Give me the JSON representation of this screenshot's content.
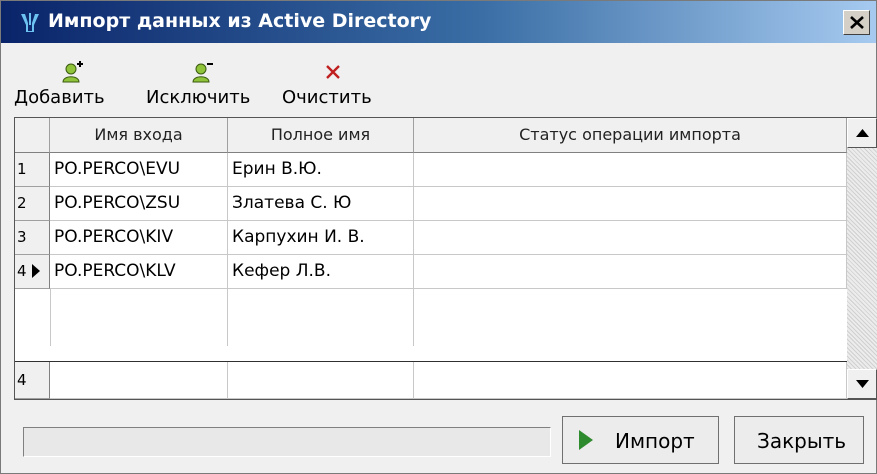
{
  "window": {
    "title": "Импорт данных из Active Directory",
    "accent": "#0a246a"
  },
  "toolbar": {
    "add_label": "Добавить",
    "add_icon": "user-add-icon",
    "exclude_label": "Исключить",
    "exclude_icon": "user-remove-icon",
    "clear_label": "Очистить",
    "clear_icon": "clear-x-icon"
  },
  "grid": {
    "columns": [
      "Имя входа",
      "Полное имя",
      "Статус операции импорта"
    ],
    "rows": [
      {
        "num": "1",
        "login": "PO.PERCO\\EVU",
        "fullname": "Ерин В.Ю.",
        "status": ""
      },
      {
        "num": "2",
        "login": "PO.PERCO\\ZSU",
        "fullname": "Златева С. Ю",
        "status": ""
      },
      {
        "num": "3",
        "login": "PO.PERCO\\KIV",
        "fullname": "Карпухин И. В.",
        "status": ""
      },
      {
        "num": "4",
        "login": "PO.PERCO\\KLV",
        "fullname": "Кефер Л.В.",
        "status": ""
      }
    ],
    "footer_count": "4"
  },
  "footer": {
    "progress": 0,
    "import_label": "Импорт",
    "close_label": "Закрыть"
  }
}
